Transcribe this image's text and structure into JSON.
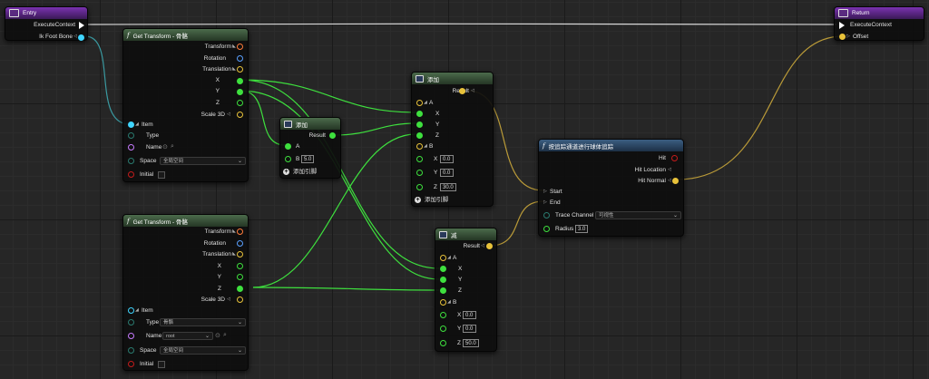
{
  "colors": {
    "exec": "#ffffff",
    "vector": "#e8c23a",
    "float": "#3ee03e",
    "rotator": "#5aa0ff",
    "transform": "#ff7b3a",
    "struct": "#3fd5ff",
    "name": "#c77bff",
    "bool": "#c41b1b",
    "byte": "#2a7a6f"
  },
  "entry": {
    "title": "Entry",
    "execute_context": "ExecuteContext",
    "ik_foot_bone": "Ik Foot Bone"
  },
  "ret": {
    "title": "Return",
    "execute_context": "ExecuteContext",
    "offset": "Offset"
  },
  "gt1": {
    "title": "Get Transform - 骨骼",
    "transform": "Transform",
    "rotation": "Rotation",
    "translation": "Translation",
    "x": "X",
    "y": "Y",
    "z": "Z",
    "scale3d": "Scale 3D",
    "item": "Item",
    "type": "Type",
    "name": "Name",
    "space": "Space",
    "space_value": "全局空间",
    "initial": "Initial"
  },
  "gt2": {
    "title": "Get Transform - 骨骼",
    "transform": "Transform",
    "rotation": "Rotation",
    "translation": "Translation",
    "x": "X",
    "y": "Y",
    "z": "Z",
    "scale3d": "Scale 3D",
    "item": "Item",
    "type": "Type",
    "type_value": "骨骼",
    "name": "Name",
    "name_value": "root",
    "space": "Space",
    "space_value": "全局空间",
    "initial": "Initial"
  },
  "add1": {
    "title": "添加",
    "result": "Result",
    "a": "A",
    "b": "B",
    "b_value": "5.0",
    "add_pin": "添加引脚"
  },
  "add2": {
    "title": "添加",
    "result": "Result",
    "a": "A",
    "x": "X",
    "y": "Y",
    "z": "Z",
    "b": "B",
    "bx": "0.0",
    "by": "0.0",
    "bz": "30.0",
    "add_pin": "添加引脚"
  },
  "sub": {
    "title": "减",
    "result": "Result",
    "a": "A",
    "x": "X",
    "y": "Y",
    "z": "Z",
    "b": "B",
    "bx": "0.0",
    "by": "0.0",
    "bz": "50.0"
  },
  "trace": {
    "title": "按追踪通道进行球体追踪",
    "hit": "Hit",
    "hit_location": "Hit Location",
    "hit_normal": "Hit Normal",
    "start": "Start",
    "end": "End",
    "trace_channel": "Trace Channel",
    "trace_channel_value": "可视性",
    "radius": "Radius",
    "radius_value": "3.0"
  }
}
